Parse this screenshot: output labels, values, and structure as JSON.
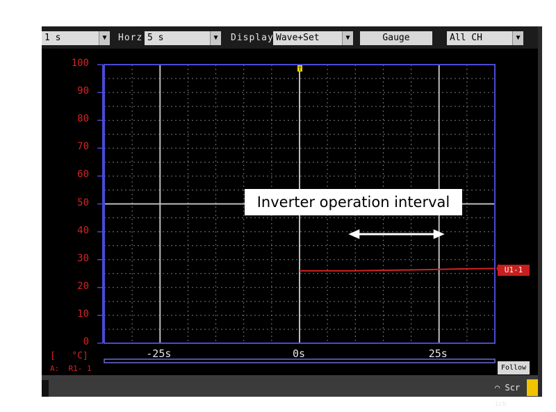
{
  "toolbar": {
    "interval_value": "1 s",
    "horz_label": "Horz",
    "horz_value": "5 s",
    "display_label": "Display",
    "display_value": "Wave+Set",
    "gauge_label": "Gauge",
    "channel_value": "All CH"
  },
  "chart_data": {
    "type": "line",
    "ylim": [
      0,
      100
    ],
    "yticks": [
      "100",
      "90",
      "80",
      "70",
      "60",
      "50",
      "40",
      "30",
      "20",
      "10",
      "0"
    ],
    "xtick_labels": [
      "-25s",
      "0s",
      "25s"
    ],
    "xlim": [
      -35,
      35
    ],
    "y_unit": "[   °C]",
    "channel_ref": "A:  R1- 1",
    "grid": true,
    "series": [
      {
        "name": "U1-1",
        "color": "#d42424",
        "x": [
          0,
          5,
          10,
          15,
          20,
          25,
          30,
          35
        ],
        "y": [
          26,
          26,
          26,
          26.2,
          26.3,
          26.5,
          26.7,
          26.8
        ]
      }
    ],
    "trigger_marker": "T",
    "annotation": "Inverter operation interval",
    "annotation_range": [
      10,
      25
    ]
  },
  "follow_label": "Follow",
  "status": {
    "scr_label": "Scr",
    "sub_label": "1ch"
  },
  "colors": {
    "axis": "#4a4ad6",
    "trace": "#d42424",
    "tick_text": "#d42424",
    "grid": "#8a8a8a"
  }
}
